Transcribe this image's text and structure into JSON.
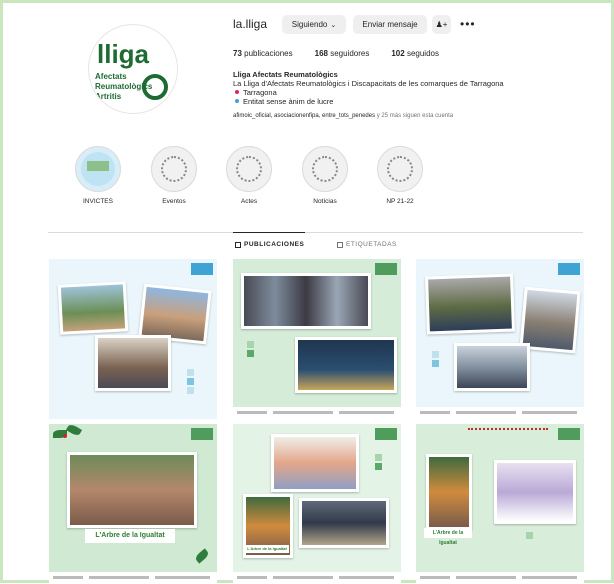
{
  "profile": {
    "username": "la.lliga",
    "follow_label": "Siguiendo",
    "message_label": "Enviar mensaje",
    "avatar_text": [
      "lliga",
      "Afectats",
      "Reumatològics",
      "Artritis"
    ],
    "stats": {
      "posts": "73",
      "posts_label": "publicaciones",
      "followers": "168",
      "followers_label": "seguidores",
      "following": "102",
      "following_label": "seguidos"
    },
    "bio": {
      "name": "Lliga Afectats Reumatològics",
      "line1": "La Lliga d'Afectats Reumatològics i Discapacitats de les comarques de Tarragona",
      "line2": "Tarragona",
      "line3": "Entitat sense ànim de lucre"
    },
    "followed_by_accounts": "afimoic_oficial, asociacionenfipa, entre_tots_penedes",
    "followed_by_rest": "y 25 más siguen esta cuenta"
  },
  "highlights": [
    {
      "label": "INVICTES"
    },
    {
      "label": "Eventos"
    },
    {
      "label": "Actes"
    },
    {
      "label": "Notícias"
    },
    {
      "label": "NP 21-22"
    }
  ],
  "tabs": {
    "posts": "PUBLICACIONES",
    "tagged": "ETIQUETADAS"
  },
  "posts": [
    {
      "caption": ""
    },
    {
      "caption": ""
    },
    {
      "caption": ""
    },
    {
      "caption": "L'Arbre de la Igualtat"
    },
    {
      "caption": "L'Arbre de la Igualtat"
    },
    {
      "caption": "L'Arbre de la Igualtat"
    }
  ],
  "colors": {
    "accent_blue": "#3fa4d3",
    "accent_green": "#4f9c5c",
    "frame_green": "#c9e6c0"
  }
}
